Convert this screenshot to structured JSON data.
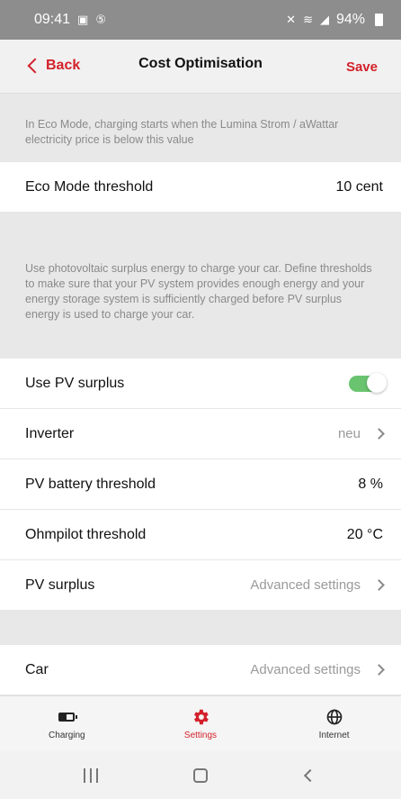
{
  "status_bar": {
    "time": "09:41",
    "battery_percent": "94%"
  },
  "header": {
    "back_label": "Back",
    "title": "Cost Optimisation",
    "save_label": "Save"
  },
  "eco": {
    "note": "In Eco Mode, charging starts when the Lumina Strom / aWattar electricity price is below this value",
    "threshold_label": "Eco Mode threshold",
    "threshold_value": "10 cent"
  },
  "pv": {
    "note": "Use photovoltaic surplus energy to charge your car. Define thresholds to make sure that your PV system provides enough energy and your energy storage system is sufficiently charged before PV surplus energy is used to charge your car.",
    "use_surplus_label": "Use PV surplus",
    "use_surplus_enabled": true,
    "inverter_label": "Inverter",
    "inverter_value": "neu",
    "battery_threshold_label": "PV battery threshold",
    "battery_threshold_value": "8 %",
    "ohmpilot_label": "Ohmpilot threshold",
    "ohmpilot_value": "20 °C",
    "surplus_label": "PV surplus",
    "surplus_value": "Advanced settings"
  },
  "car": {
    "label": "Car",
    "value": "Advanced settings"
  },
  "bottom_nav": {
    "items": [
      {
        "label": "Charging",
        "icon": "battery-icon"
      },
      {
        "label": "Settings",
        "icon": "gear-icon",
        "active": true
      },
      {
        "label": "Internet",
        "icon": "globe-icon"
      }
    ]
  },
  "colors": {
    "accent": "#d3202a",
    "toggle_on": "#6ac46f"
  }
}
